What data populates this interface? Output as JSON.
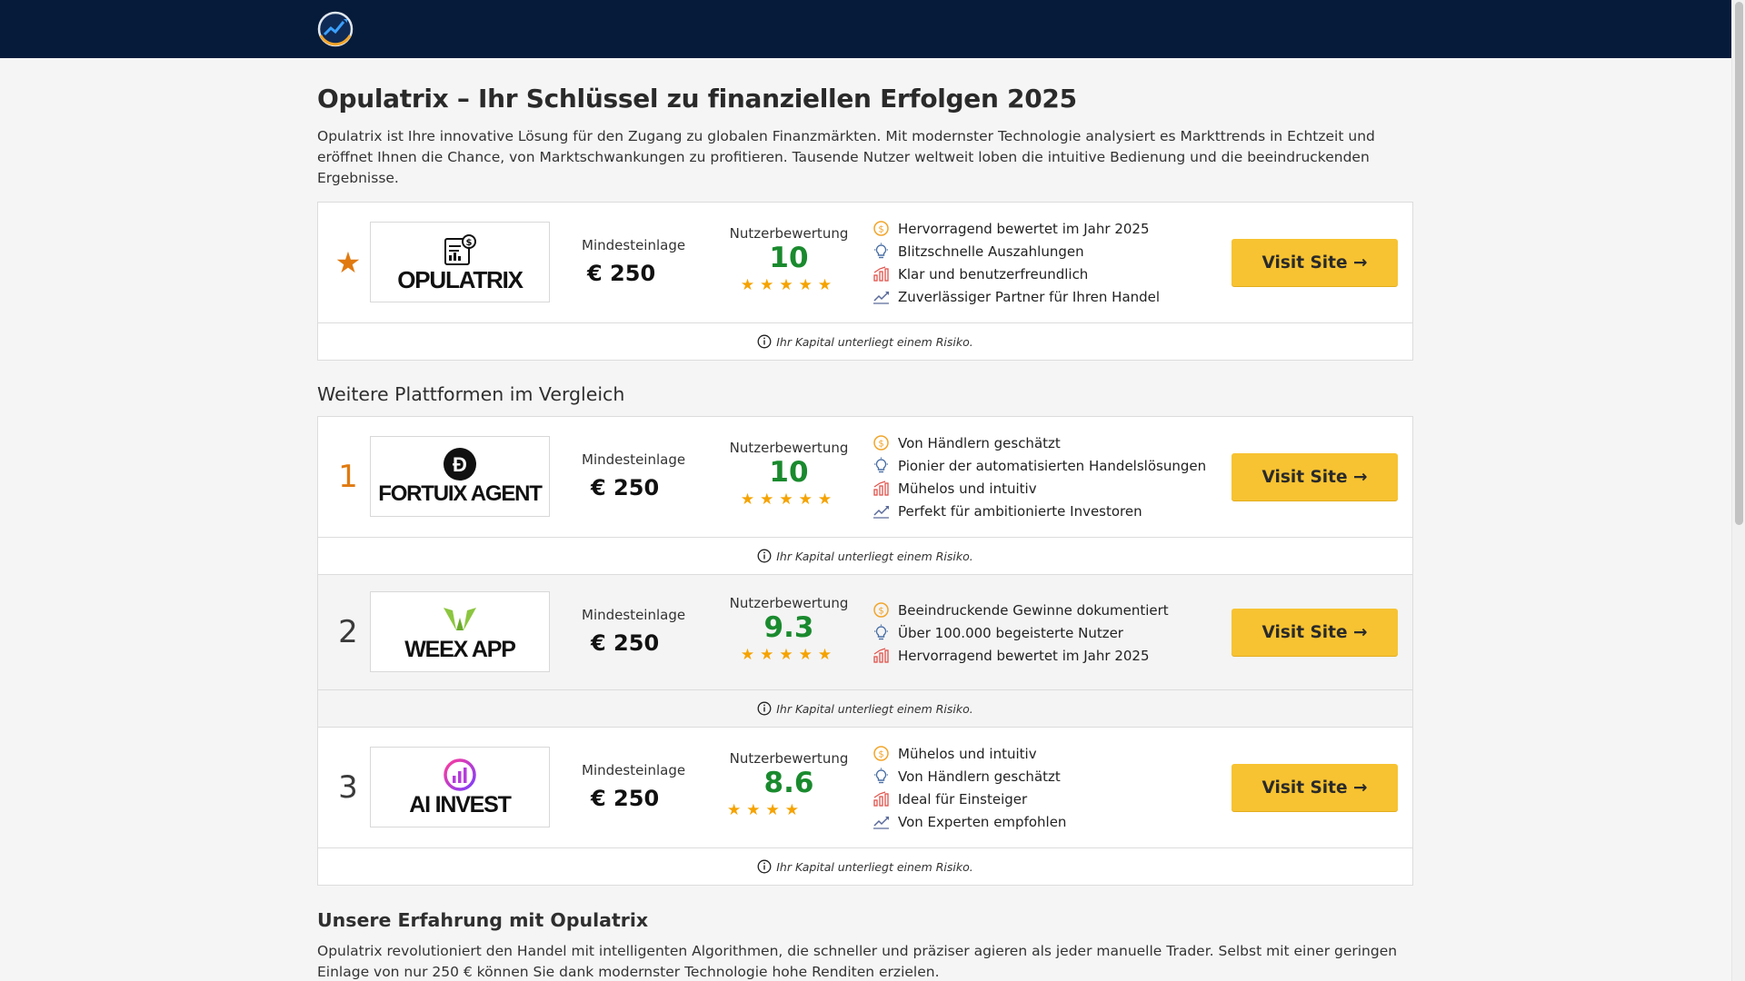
{
  "header": {
    "logo_icon": "chart-globe-logo-icon",
    "colors": {
      "bar": "#061b3a"
    }
  },
  "page": {
    "title": "Opulatrix – Ihr Schlüssel zu finanziellen Erfolgen 2025",
    "intro": "Opulatrix ist Ihre innovative Lösung für den Zugang zu globalen Finanzmärkten. Mit modernster Technologie analysiert es Markttrends in Echtzeit und eröffnet Ihnen die Chance, von Marktschwankungen zu profitieren. Tausende Nutzer weltweit loben die intuitive Bedienung und die beeindruckenden Ergebnisse.",
    "comparison_heading": "Weitere Plattformen im Vergleich",
    "experience_heading": "Unsere Erfahrung mit Opulatrix",
    "experience_text": "Opulatrix revolutioniert den Handel mit intelligenten Algorithmen, die schneller und präziser agieren als jeder manuelle Trader. Selbst mit einer geringen Einlage von nur 250 € können Sie dank modernster Technologie hohe Renditen erzielen."
  },
  "labels": {
    "deposit": "Mindesteinlage",
    "rating": "Nutzerbewertung",
    "visit": "Visit Site →",
    "risk": "Ihr Kapital unterliegt einem Risiko."
  },
  "colors": {
    "accent": "#f7c332",
    "rating_green": "#1a8a2e",
    "rank_orange": "#e07a10",
    "star": "#f5a300"
  },
  "featured": {
    "rank": "★",
    "brand": "OPULATRIX",
    "deposit": "€  250",
    "rating": "10",
    "stars": 5,
    "features": [
      "Hervorragend bewertet im Jahr 2025",
      "Blitzschnelle Auszahlungen",
      "Klar und benutzerfreundlich",
      "Zuverlässiger Partner für Ihren Handel"
    ]
  },
  "platforms": [
    {
      "rank": "1",
      "brand": "FORTUIX AGENT",
      "deposit": "€  250",
      "rating": "10",
      "stars": 5,
      "features": [
        "Von Händlern geschätzt",
        "Pionier der automatisierten Handelslösungen",
        "Mühelos und intuitiv",
        "Perfekt für ambitionierte Investoren"
      ]
    },
    {
      "rank": "2",
      "brand": "WEEX APP",
      "deposit": "€  250",
      "rating": "9.3",
      "stars": 5,
      "features": [
        "Beeindruckende Gewinne dokumentiert",
        "Über 100.000 begeisterte Nutzer",
        "Hervorragend bewertet im Jahr 2025"
      ]
    },
    {
      "rank": "3",
      "brand": "AI INVEST",
      "deposit": "€  250",
      "rating": "8.6",
      "stars": 4,
      "features": [
        "Mühelos und intuitiv",
        "Von Händlern geschätzt",
        "Ideal für Einsteiger",
        "Von Experten empfohlen"
      ]
    }
  ],
  "star_strings": {
    "five": "★★★★★",
    "four": "★★★★"
  },
  "feature_icons": [
    "coin-icon",
    "lightbulb-icon",
    "bar-chart-icon",
    "trend-line-icon"
  ]
}
